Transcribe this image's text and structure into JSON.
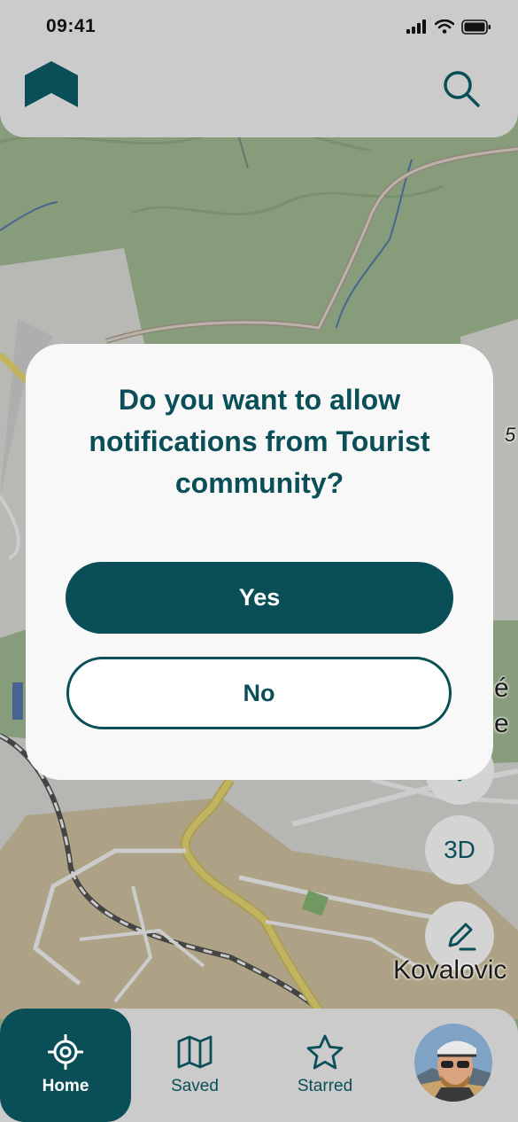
{
  "status_bar": {
    "time": "09:41",
    "icons": [
      "signal-icon",
      "wifi-icon",
      "battery-icon"
    ]
  },
  "header": {
    "logo_icon": "bookmark-logo-icon",
    "search_icon": "search-icon"
  },
  "map": {
    "labels": [
      "Kovalovic",
      "é",
      "e",
      "5"
    ],
    "buttons": [
      {
        "name": "layers",
        "icon": "layers-icon"
      },
      {
        "name": "3d",
        "label": "3D"
      },
      {
        "name": "edit",
        "icon": "pencil-icon"
      }
    ]
  },
  "dialog": {
    "title": "Do you want to allow notifications from Tourist community?",
    "yes_label": "Yes",
    "no_label": "No"
  },
  "bottom_nav": {
    "items": [
      {
        "label": "Home",
        "icon": "target-icon",
        "active": true
      },
      {
        "label": "Saved",
        "icon": "map-icon",
        "active": false
      },
      {
        "label": "Starred",
        "icon": "star-icon",
        "active": false
      }
    ],
    "avatar_icon": "profile-avatar"
  },
  "colors": {
    "primary": "#0a4f58",
    "map_green": "#a9c59a",
    "map_tan": "#d9cba7",
    "road_yellow": "#f2e27a"
  }
}
